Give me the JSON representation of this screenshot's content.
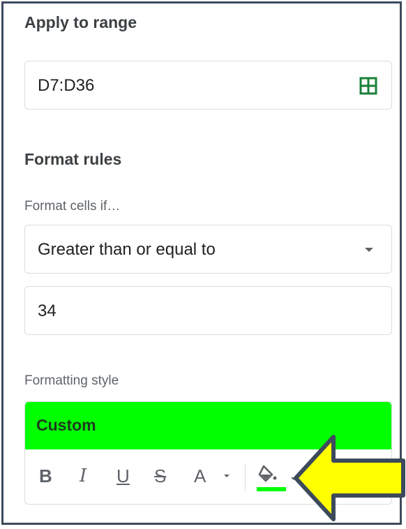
{
  "apply_to_range": {
    "heading": "Apply to range",
    "range_value": "D7:D36"
  },
  "format_rules": {
    "heading": "Format rules",
    "condition_label": "Format cells if…",
    "condition_selected": "Greater than or equal to",
    "value": "34"
  },
  "formatting_style": {
    "label": "Formatting style",
    "preset_name": "Custom",
    "preview_background": "#00ff00",
    "toolbar": {
      "bold": "B",
      "italic": "I",
      "underline": "U",
      "strikethrough": "S",
      "text_color": "A"
    },
    "fill_color": "#00ff00"
  },
  "annotation": {
    "arrow_color": "#ffff00",
    "arrow_outline": "#3d4a5c"
  }
}
